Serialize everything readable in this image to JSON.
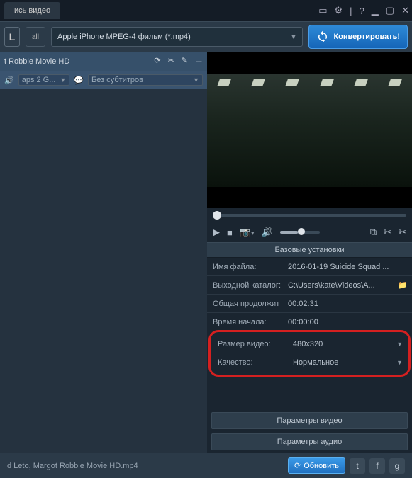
{
  "titlebar": {
    "tab_label": "ись видео"
  },
  "toolbar": {
    "mode_label": "L",
    "preset_icon_label": "all",
    "preset_label": "Apple iPhone MPEG-4 фильм (*.mp4)",
    "convert_label": "Конвертировать!"
  },
  "item": {
    "title": "t Robbie Movie HD",
    "audio_dd": "aps 2 G...",
    "subtitle_dd": "Без субтитров"
  },
  "settings": {
    "header": "Базовые установки",
    "rows": [
      {
        "label": "Имя файла:",
        "value": "2016-01-19 Suicide Squad ..."
      },
      {
        "label": "Выходной каталог:",
        "value": "C:\\Users\\kate\\Videos\\A..."
      },
      {
        "label": "Общая продолжит",
        "value": "00:02:31"
      },
      {
        "label": "Время начала:",
        "value": "00:00:00"
      }
    ],
    "highlighted": [
      {
        "label": "Размер видео:",
        "value": "480x320"
      },
      {
        "label": "Качество:",
        "value": "Нормальное"
      }
    ],
    "video_params": "Параметры видео",
    "audio_params": "Параметры аудио"
  },
  "statusbar": {
    "filename": "d Leto, Margot Robbie Movie HD.mp4",
    "refresh_label": "Обновить"
  }
}
